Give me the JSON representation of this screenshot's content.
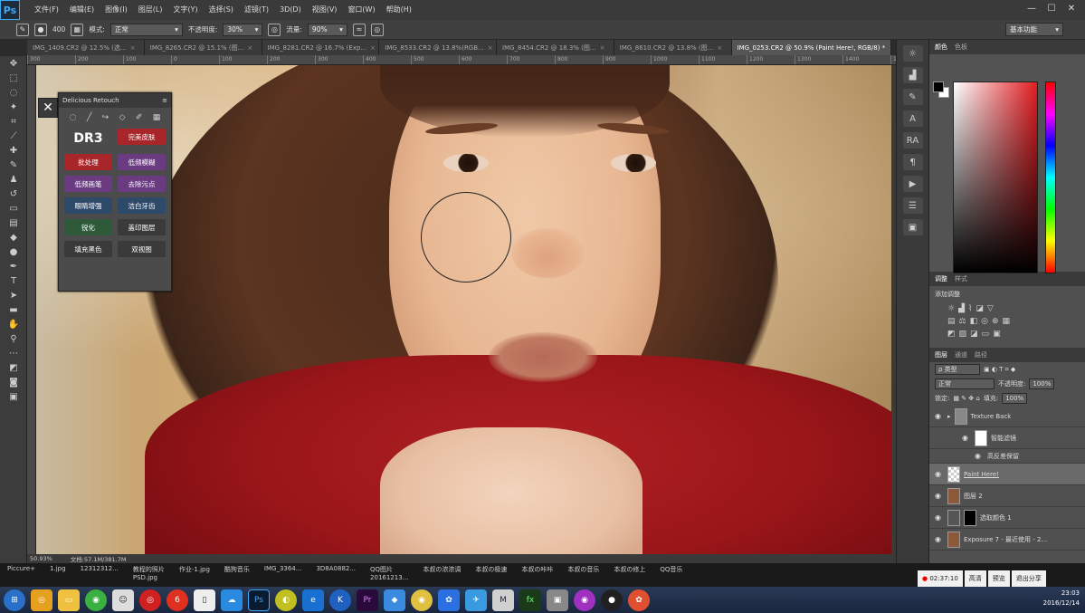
{
  "app": {
    "logo": "Ps",
    "menus": [
      "文件(F)",
      "编辑(E)",
      "图像(I)",
      "图层(L)",
      "文字(Y)",
      "选择(S)",
      "滤镜(T)",
      "3D(D)",
      "视图(V)",
      "窗口(W)",
      "帮助(H)"
    ],
    "win_min": "—",
    "win_max": "☐",
    "win_close": "✕"
  },
  "options": {
    "brush_size": "400",
    "mode_label": "模式:",
    "mode_value": "正常",
    "opacity_label": "不透明度:",
    "opacity_value": "30%",
    "flow_label": "流量:",
    "flow_value": "90%",
    "workspace": "基本功能"
  },
  "tabs": [
    {
      "label": "IMG_1409.CR2 @ 12.5% (选..."
    },
    {
      "label": "IMG_8265.CR2 @ 15.1% (图..."
    },
    {
      "label": "IMG_8281.CR2 @ 16.7% (Exp..."
    },
    {
      "label": "IMG_8533.CR2 @ 13.8%(RGB..."
    },
    {
      "label": "IMG_8454.CR2 @ 18.3% (图..."
    },
    {
      "label": "IMG_8610.CR2 @ 13.8% (图..."
    },
    {
      "label": "IMG_0253.CR2 @ 50.9% (Paint Here!, RGB/8) *"
    }
  ],
  "ruler": [
    "300",
    "200",
    "100",
    "0",
    "100",
    "200",
    "300",
    "400",
    "500",
    "600",
    "700",
    "800",
    "900",
    "1000",
    "1100",
    "1200",
    "1300",
    "1400",
    "1500",
    "1600",
    "1700",
    "1800",
    "1900",
    "2000",
    "2100",
    "2200",
    "2300"
  ],
  "dr3": {
    "title": "Delicious Retouch",
    "logo": "DR3",
    "buttons": [
      [
        "完美皮肤"
      ],
      [
        "批处理",
        "低频模糊"
      ],
      [
        "低频画笔",
        "去除污点"
      ],
      [
        "眼睛增强",
        "洁白牙齿"
      ],
      [
        "锐化",
        "盖印图层"
      ],
      [
        "填充黑色",
        "双视图"
      ]
    ]
  },
  "right": {
    "color_tabs": [
      "颜色",
      "色板"
    ],
    "adj_tabs": [
      "调整",
      "样式"
    ],
    "adj_title": "添加调整",
    "layer_tabs": [
      "图层",
      "通道",
      "路径"
    ],
    "kind": "ρ 类型",
    "blend": "正常",
    "opacity_label": "不透明度:",
    "opacity": "100%",
    "lock": "锁定:",
    "fill_label": "填充:",
    "fill": "100%",
    "layers": [
      "Texture Back",
      "智能滤镜",
      "高反差保留",
      "Paint Here!",
      "图层 2",
      "选取颜色 1",
      "Exposure 7 - 最近使用 - 2..."
    ]
  },
  "status": {
    "zoom": "50.93%",
    "doc": "文档:57.1M/381.7M"
  },
  "files": [
    "Piccure+",
    "1.jpg",
    "12312312...",
    "教程的照片\nPSD.jpg",
    "作业-1.jpg",
    "酷狗音乐",
    "IMG_3364...",
    "3D8A0882...",
    "QQ图片\n20161213...",
    "本叔の浓浓调",
    "本叔の极速",
    "本叔の咔咔",
    "本叔の音乐",
    "本叔の修上",
    "QQ音乐"
  ],
  "recorder": {
    "time": "02:37:10",
    "quality": "高清",
    "preview": "预览",
    "share": "退出分享"
  },
  "clock": {
    "time": "23:03",
    "date": "2016/12/14"
  },
  "taskbar": [
    "⊞",
    "Ps",
    "Pr",
    "K",
    "e",
    "fx"
  ],
  "colors": {
    "accent": "#3fa9f5",
    "scarf": "#9a1619",
    "dr3_red": "#a8252a"
  }
}
